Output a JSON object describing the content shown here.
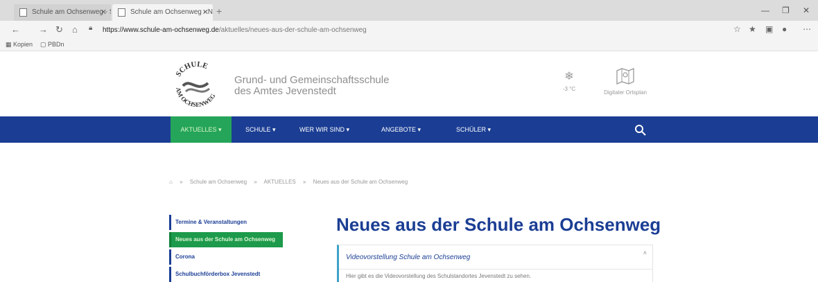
{
  "browser": {
    "tabs": [
      {
        "label": "Schule am Ochsenweg - Schulb"
      },
      {
        "label": "Schule am Ochsenweg - Neues"
      }
    ],
    "url_domain": "https://www.schule-am-ochsenweg.de",
    "url_path": "/aktuelles/neues-aus-der-schule-am-ochsenweg",
    "bookmarks": [
      {
        "label": "Kopien"
      },
      {
        "label": "PBDn"
      }
    ]
  },
  "header": {
    "logo_text_top": "SCHULE",
    "logo_text_bottom": "AM OCHSENWEG",
    "school_name_line1": "Grund- und Gemeinschaftsschule",
    "school_name_line2": "des Amtes Jevenstedt",
    "weather_temp": "-3 °C",
    "ortsplan_label": "Digitaler Ortsplan"
  },
  "nav": {
    "items": [
      {
        "label": "AKTUELLES ▾"
      },
      {
        "label": "SCHULE ▾"
      },
      {
        "label": "WER WIR SIND ▾"
      },
      {
        "label": "ANGEBOTE ▾"
      },
      {
        "label": "SCHÜLER ▾"
      }
    ]
  },
  "breadcrumb": {
    "home": "⌂",
    "sep": "»",
    "items": [
      "Schule am Ochsenweg",
      "AKTUELLES",
      "Neues aus der Schule am Ochsenweg"
    ]
  },
  "sidebar": {
    "items": [
      {
        "label": "Termine & Veranstaltungen"
      },
      {
        "label": "Neues aus der Schule am Ochsenweg"
      },
      {
        "label": "Corona"
      },
      {
        "label": "Schulbuchförderbox Jevenstedt"
      }
    ]
  },
  "main": {
    "title": "Neues aus der Schule am Ochsenweg",
    "card_heading": "Videovorstellung Schule am Ochsenweg",
    "card_text": "Hier gibt es die Videovorstellung des Schulstandortes Jevenstedt zu sehen."
  },
  "colors": {
    "nav_blue": "#1b3e94",
    "accent_green": "#25a559",
    "title_blue": "#1b3e94"
  }
}
